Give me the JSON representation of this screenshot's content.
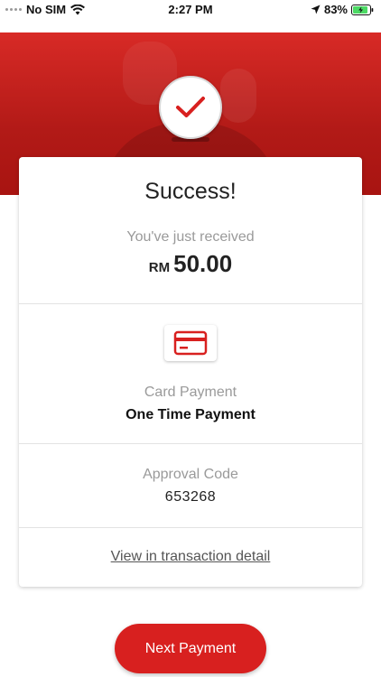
{
  "status_bar": {
    "carrier": "No SIM",
    "time": "2:27 PM",
    "battery": "83%"
  },
  "result": {
    "title": "Success!",
    "received_label": "You've just received",
    "currency": "RM",
    "amount": "50.00"
  },
  "payment": {
    "method_label": "Card Payment",
    "type": "One Time Payment"
  },
  "approval": {
    "label": "Approval Code",
    "code": "653268"
  },
  "links": {
    "view_detail": "View in transaction detail"
  },
  "actions": {
    "next_payment": "Next Payment"
  },
  "colors": {
    "brand_red": "#d8201f",
    "header_red": "#c0201c",
    "battery_green": "#4cd964"
  },
  "icons": {
    "success": "checkmark-icon",
    "payment_method": "credit-card-icon"
  }
}
